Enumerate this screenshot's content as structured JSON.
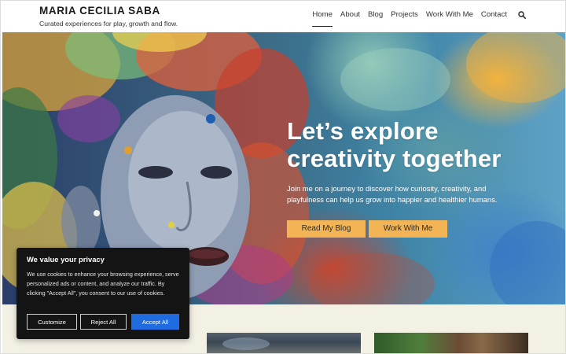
{
  "header": {
    "site_title": "MARIA CECILIA SABA",
    "tagline": "Curated experiences for play, growth and flow.",
    "nav": [
      {
        "label": "Home",
        "active": true
      },
      {
        "label": "About",
        "active": false
      },
      {
        "label": "Blog",
        "active": false
      },
      {
        "label": "Projects",
        "active": false
      },
      {
        "label": "Work With Me",
        "active": false
      },
      {
        "label": "Contact",
        "active": false
      }
    ],
    "search_icon": "search-icon"
  },
  "hero": {
    "heading_line1": "Let’s explore",
    "heading_line2": "creativity together",
    "subtitle": "Join me on a journey to discover how curiosity, creativity, and playfulness can help us grow into happier and healthier humans.",
    "buttons": {
      "blog": "Read My Blog",
      "work": "Work With Me"
    },
    "button_color": "#f2b455"
  },
  "cookie_banner": {
    "title": "We value your privacy",
    "text": "We use cookies to enhance your browsing experience, serve personalized ads or content, and analyze our traffic. By clicking \"Accept All\", you consent to our use of cookies.",
    "buttons": {
      "customize": "Customize",
      "reject": "Reject All",
      "accept": "Accept All"
    },
    "accept_color": "#1e6ce0"
  }
}
